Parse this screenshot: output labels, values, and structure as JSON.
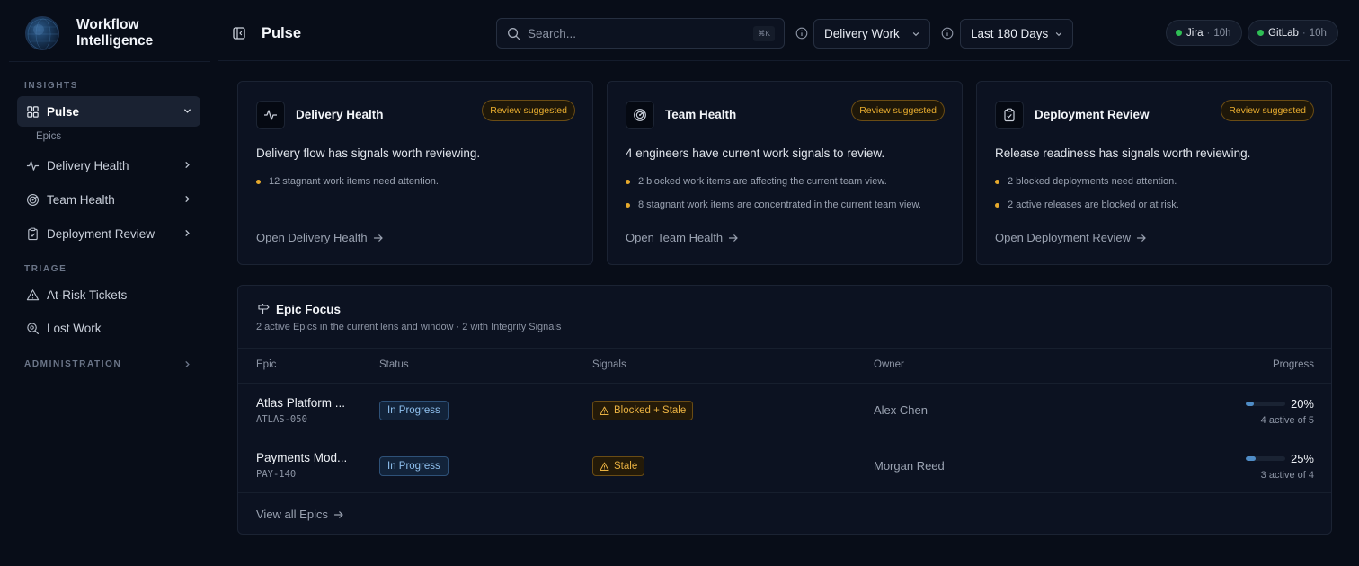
{
  "app": {
    "title": "Workflow Intelligence"
  },
  "sidebar": {
    "insights_label": "INSIGHTS",
    "triage_label": "TRIAGE",
    "administration_label": "ADMINISTRATION",
    "pulse": {
      "label": "Pulse",
      "icon": "grid-icon",
      "sub": "Epics"
    },
    "items": [
      {
        "label": "Delivery Health",
        "icon": "activity-icon"
      },
      {
        "label": "Team Health",
        "icon": "radar-icon"
      },
      {
        "label": "Deployment Review",
        "icon": "clipboard-check-icon"
      }
    ],
    "triage": [
      {
        "label": "At-Risk Tickets",
        "icon": "warning-icon"
      },
      {
        "label": "Lost Work",
        "icon": "search-zoom-icon"
      }
    ]
  },
  "topbar": {
    "title": "Pulse",
    "search_placeholder": "Search...",
    "search_shortcut": "⌘K",
    "lens": "Delivery Work",
    "window": "Last 180 Days",
    "sources": [
      {
        "name": "Jira",
        "age": "10h",
        "status_color": "#2fbf55"
      },
      {
        "name": "GitLab",
        "age": "10h",
        "status_color": "#2fbf55"
      }
    ]
  },
  "cards": [
    {
      "title": "Delivery Health",
      "badge": "Review suggested",
      "summary": "Delivery flow has signals worth reviewing.",
      "bullets": [
        "12 stagnant work items need attention."
      ],
      "link": "Open Delivery Health"
    },
    {
      "title": "Team Health",
      "badge": "Review suggested",
      "summary": "4 engineers have current work signals to review.",
      "bullets": [
        "2 blocked work items are affecting the current team view.",
        "8 stagnant work items are concentrated in the current team view."
      ],
      "link": "Open Team Health"
    },
    {
      "title": "Deployment Review",
      "badge": "Review suggested",
      "summary": "Release readiness has signals worth reviewing.",
      "bullets": [
        "2 blocked deployments need attention.",
        "2 active releases are blocked or at risk."
      ],
      "link": "Open Deployment Review"
    }
  ],
  "epic_focus": {
    "title": "Epic Focus",
    "subtitle": "2 active Epics in the current lens and window · 2 with Integrity Signals",
    "columns": [
      "Epic",
      "Status",
      "Signals",
      "Owner",
      "Progress"
    ],
    "rows": [
      {
        "name": "Atlas Platform ...",
        "key": "ATLAS-050",
        "status": "In Progress",
        "signal": "Blocked + Stale",
        "owner": "Alex Chen",
        "progress_pct": "20%",
        "progress": 0.2,
        "progress_note": "4 active of 5"
      },
      {
        "name": "Payments Mod...",
        "key": "PAY-140",
        "status": "In Progress",
        "signal": "Stale",
        "owner": "Morgan Reed",
        "progress_pct": "25%",
        "progress": 0.25,
        "progress_note": "3 active of 4"
      }
    ],
    "view_all": "View all Epics"
  },
  "colors": {
    "background": "#080d18",
    "card": "#0c1221",
    "warning": "#e9ad2f",
    "status_blue": "#8fc0ee",
    "progress_blue": "#4f8cc6",
    "source_ok": "#2fbf55"
  }
}
